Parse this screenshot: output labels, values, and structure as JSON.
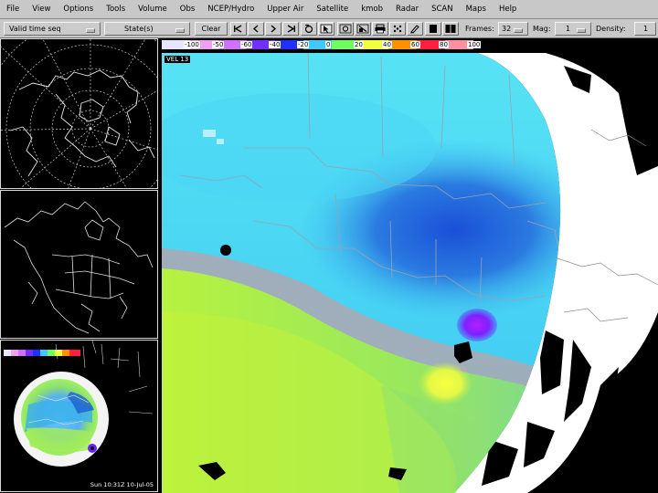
{
  "menu": {
    "items": [
      "File",
      "View",
      "Options",
      "Tools",
      "Volume",
      "Obs",
      "NCEP/Hydro",
      "Upper Air",
      "Satellite",
      "kmob",
      "Radar",
      "SCAN",
      "Maps",
      "Help"
    ]
  },
  "toolbar": {
    "time_mode": "Valid time seq",
    "state": "State(s)",
    "clear": "Clear",
    "frames_label": "Frames:",
    "frames_value": "32",
    "mag_label": "Mag:",
    "mag_value": "1",
    "density_label": "Density:",
    "density_value": "1"
  },
  "colorbar": {
    "labels": [
      "-100",
      "-50",
      "-60",
      "-40",
      "-20",
      "0",
      "20",
      "40",
      "60",
      "80",
      "100"
    ],
    "colors": [
      "#e6e6ff",
      "#f0a0f0",
      "#d070ff",
      "#7030ff",
      "#2030ff",
      "#40c8ff",
      "#70ff60",
      "#f0ff40",
      "#ff9000",
      "#ff2040",
      "#ff90a0"
    ]
  },
  "main_view": {
    "velocity_label": "VEL 13"
  },
  "inset": {
    "timestamp": "Sun 10:31Z 10-Jul-05"
  },
  "colors": {
    "ui_gray": "#c8c8c8",
    "velocity_cyan": "#40c8ff",
    "velocity_blue": "#2a6ad8",
    "velocity_green": "#9cf060",
    "velocity_yellow": "#f0ff40",
    "velocity_purple": "#8020ff"
  }
}
